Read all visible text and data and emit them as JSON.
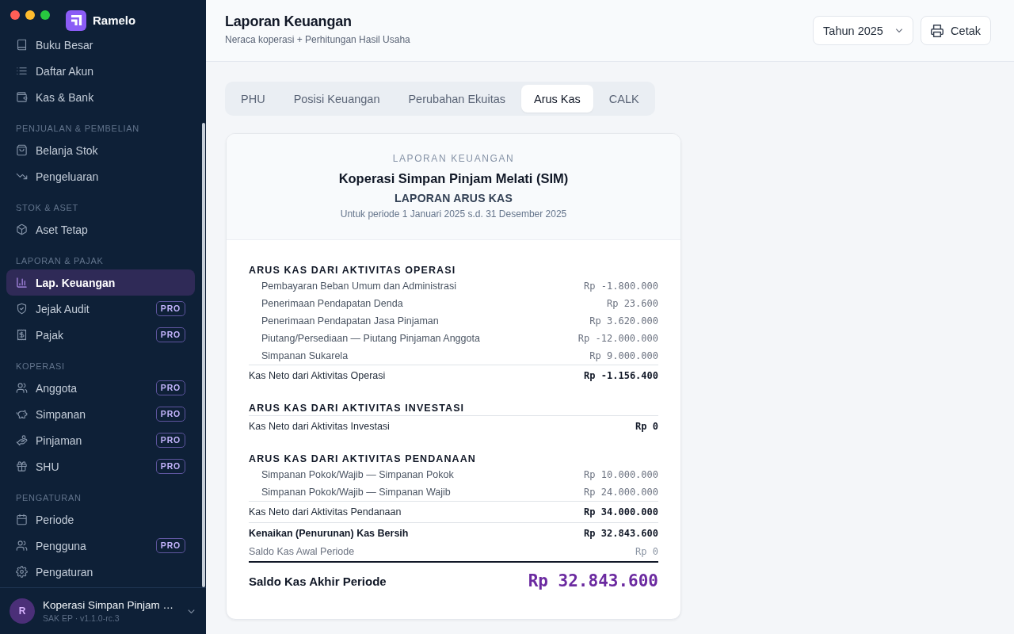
{
  "window": {
    "app_name": "Ramelo"
  },
  "sidebar": {
    "sections": [
      {
        "items": [
          {
            "label": "Buku Besar",
            "selected": false
          },
          {
            "label": "Daftar Akun",
            "selected": false
          },
          {
            "label": "Kas & Bank",
            "selected": false
          }
        ]
      },
      {
        "label": "PENJUALAN & PEMBELIAN",
        "items": [
          {
            "label": "Belanja Stok",
            "selected": false
          },
          {
            "label": "Pengeluaran",
            "selected": false
          }
        ]
      },
      {
        "label": "STOK & ASET",
        "items": [
          {
            "label": "Aset Tetap",
            "selected": false
          }
        ]
      },
      {
        "label": "LAPORAN & PAJAK",
        "items": [
          {
            "label": "Lap. Keuangan",
            "selected": true
          },
          {
            "label": "Jejak Audit",
            "selected": false,
            "badge": "PRO"
          },
          {
            "label": "Pajak",
            "selected": false,
            "badge": "PRO"
          }
        ]
      },
      {
        "label": "KOPERASI",
        "items": [
          {
            "label": "Anggota",
            "selected": false,
            "badge": "PRO"
          },
          {
            "label": "Simpanan",
            "selected": false,
            "badge": "PRO"
          },
          {
            "label": "Pinjaman",
            "selected": false,
            "badge": "PRO"
          },
          {
            "label": "SHU",
            "selected": false,
            "badge": "PRO"
          }
        ]
      },
      {
        "label": "PENGATURAN",
        "items": [
          {
            "label": "Periode",
            "selected": false
          },
          {
            "label": "Pengguna",
            "selected": false,
            "badge": "PRO"
          },
          {
            "label": "Pengaturan",
            "selected": false
          }
        ]
      }
    ],
    "account": {
      "initial": "R",
      "name": "Koperasi Simpan Pinjam …",
      "subtitle": "SAK EP · v1.1.0-rc.3"
    }
  },
  "header": {
    "title": "Laporan Keuangan",
    "subtitle": "Neraca koperasi + Perhitungan Hasil Usaha",
    "year_select": "Tahun 2025",
    "print_button": "Cetak"
  },
  "tabs": [
    {
      "label": "PHU",
      "selected": false
    },
    {
      "label": "Posisi Keuangan",
      "selected": false
    },
    {
      "label": "Perubahan Ekuitas",
      "selected": false
    },
    {
      "label": "Arus Kas",
      "selected": true
    },
    {
      "label": "CALK",
      "selected": false
    }
  ],
  "report": {
    "eyebrow": "LAPORAN KEUANGAN",
    "organization": "Koperasi Simpan Pinjam Melati (SIM)",
    "title": "LAPORAN ARUS KAS",
    "period": "Untuk periode 1 Januari 2025 s.d. 31 Desember 2025",
    "sections": [
      {
        "heading": "ARUS KAS DARI AKTIVITAS OPERASI",
        "lines": [
          {
            "label": "Pembayaran Beban Umum dan Administrasi",
            "amount": "Rp -1.800.000"
          },
          {
            "label": "Penerimaan Pendapatan Denda",
            "amount": "Rp 23.600"
          },
          {
            "label": "Penerimaan Pendapatan Jasa Pinjaman",
            "amount": "Rp 3.620.000"
          },
          {
            "label": "Piutang/Persediaan — Piutang Pinjaman Anggota",
            "amount": "Rp -12.000.000"
          },
          {
            "label": "Simpanan Sukarela",
            "amount": "Rp 9.000.000"
          }
        ],
        "total": {
          "label": "Kas Neto dari Aktivitas Operasi",
          "amount": "Rp -1.156.400"
        }
      },
      {
        "heading": "ARUS KAS DARI AKTIVITAS INVESTASI",
        "total": {
          "label": "Kas Neto dari Aktivitas Investasi",
          "amount": "Rp 0"
        }
      },
      {
        "heading": "ARUS KAS DARI AKTIVITAS PENDANAAN",
        "lines": [
          {
            "label": "Simpanan Pokok/Wajib — Simpanan Pokok",
            "amount": "Rp 10.000.000"
          },
          {
            "label": "Simpanan Pokok/Wajib — Simpanan Wajib",
            "amount": "Rp 24.000.000"
          }
        ],
        "total": {
          "label": "Kas Neto dari Aktivitas Pendanaan",
          "amount": "Rp 34.000.000"
        }
      }
    ],
    "summary": [
      {
        "kind": "net_change",
        "label": "Kenaikan (Penurunan) Kas Bersih",
        "amount": "Rp 32.843.600"
      },
      {
        "kind": "opening",
        "label": "Saldo Kas Awal Periode",
        "amount": "Rp 0"
      }
    ],
    "closing": {
      "label": "Saldo Kas Akhir Periode",
      "amount": "Rp 32.843.600"
    }
  }
}
